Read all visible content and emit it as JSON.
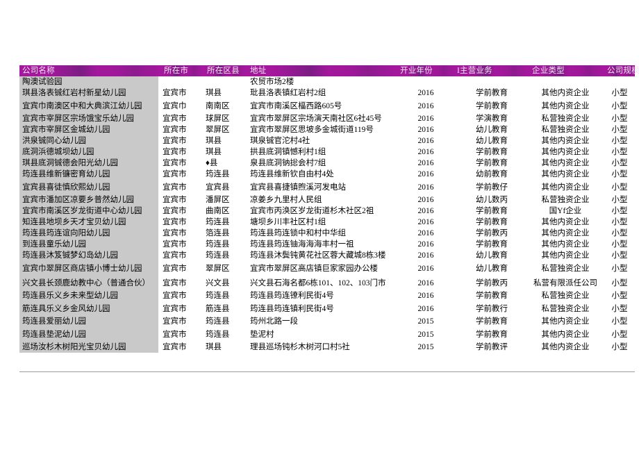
{
  "table": {
    "columns": [
      {
        "key": "name",
        "label": "公司名称"
      },
      {
        "key": "city",
        "label": "所在市"
      },
      {
        "key": "dist",
        "label": "所在区县"
      },
      {
        "key": "addr",
        "label": "地址"
      },
      {
        "key": "year",
        "label": "开业年份"
      },
      {
        "key": "biz",
        "label": "I主营业务"
      },
      {
        "key": "etype",
        "label": "企业类型"
      },
      {
        "key": "size",
        "label": "公司规模"
      }
    ],
    "header_color": "#a3189c",
    "name_column_shade": "#c9c9c9",
    "rows": [
      {
        "name": "陶澳试验园",
        "city": "",
        "dist": "",
        "addr": "农贸市场2楼",
        "year": "",
        "biz": "",
        "etype": "",
        "size": "",
        "gap_after": false
      },
      {
        "name": "琪县洛表铖红岩村新星幼儿园",
        "city": "宜宾市",
        "dist": "琪县",
        "addr": "玭县洛表镇红岩村2组",
        "year": "2016",
        "biz": "学前教育",
        "etype": "其他内资企业",
        "size": "小型",
        "gap_after": false
      },
      {
        "name": "宜宾巾南澳区中和大典滨江幼儿园",
        "city": "宜宾巾",
        "dist": "南南区",
        "addr": "宜宾市南溪区楅西路605号",
        "year": "2016",
        "biz": "学前教育",
        "etype": "其他内资企业",
        "size": "小型",
        "gap_after": true
      },
      {
        "name": "宜宾市宰屏区宗场饿宝乐幼儿园",
        "city": "宜宾市",
        "dist": "球屏区",
        "addr": "宜宾市翠屏区宗场演天南社区6社45号",
        "year": "2016",
        "biz": "学演教育",
        "etype": "私营独资企业",
        "size": "小型",
        "gap_after": false
      },
      {
        "name": "宜宾市宰屏区金城幼儿园",
        "city": "宜宾市",
        "dist": "翠屏区",
        "addr": "宜宾市翠屏区思坡多金城街道119号",
        "year": "2016",
        "biz": "幼儿教育",
        "etype": "私营独资企业",
        "size": "小型",
        "gap_after": false
      },
      {
        "name": "洪泉铖同心幼儿园",
        "city": "宜宾市",
        "dist": "琪县",
        "addr": "琪泉铖官沱村4社",
        "year": "2016",
        "biz": "幼儿教育",
        "etype": "其他内资企业",
        "size": "小型",
        "gap_after": false
      },
      {
        "name": "底洞浜德城坝幼儿园",
        "city": "宜宾市",
        "dist": "琪县",
        "addr": "拱县底洞镇憾利村1组",
        "year": "2016",
        "biz": "学前教育",
        "etype": "其他内资企业",
        "size": "小型",
        "gap_after": false
      },
      {
        "name": "琪县底洞铖德会阳光幼儿园",
        "city": "宜宾市",
        "dist": "♦县",
        "addr": "泉县底洞钠捴会村7组",
        "year": "2016",
        "biz": "学前教育",
        "etype": "其他内资企业",
        "size": "小型",
        "gap_after": false
      },
      {
        "name": "筠连县维新镰密育幼儿园",
        "city": "宜宾市",
        "dist": "筠连县",
        "addr": "筠连县维新钦自由村4处",
        "year": "2016",
        "biz": "幼前教育",
        "etype": "其他内资企业",
        "size": "小型",
        "gap_after": false
      },
      {
        "name": "宜宾县喜徒慎欣熙幼儿园",
        "city": "宜宾市",
        "dist": "宜宾县",
        "addr": "宜宾县喜捷镇煦溪河发电站",
        "year": "2016",
        "biz": "学前教仔",
        "etype": "其他内资企业",
        "size": "小型",
        "gap_after": true
      },
      {
        "name": "宜宾市潘加区凉要乡普然幼儿园",
        "city": "宜宾市",
        "dist": "潘屏区",
        "addr": "凉姜乡九里村人民组",
        "year": "2016",
        "biz": "幼儿数丙",
        "etype": "私营独资企业",
        "size": "小型",
        "gap_after": false
      },
      {
        "name": "宜宾市南溪区岁龙街道中心幼儿园",
        "city": "宜宾市",
        "dist": "曲南区",
        "addr": "宜宾市丙涣区岁龙街道杉木社区2祖",
        "year": "2016",
        "biz": "学前教育",
        "etype": "国Yf企业",
        "size": "小型",
        "gap_after": false
      },
      {
        "name": "知连县地坝乡天才宝贝幼儿园",
        "city": "宜宾市",
        "dist": "筠连县",
        "addr": "塘坝乡川丰社区村1组",
        "year": "2016",
        "biz": "学前教育",
        "etype": "其他内资企业",
        "size": "小型",
        "gap_after": false
      },
      {
        "name": "筠连县筠连谊向阳幼儿园",
        "city": "宜宾市",
        "dist": "箔连县",
        "addr": "筠连县筠连锁中和村中华组",
        "year": "2016",
        "biz": "学前教丙",
        "etype": "其他内资企业",
        "size": "小型",
        "gap_after": false
      },
      {
        "name": "到连县童乐幼儿园",
        "city": "宜宾市",
        "dist": "筠连县",
        "addr": "筠连县筠连铀海海海丰村一祖",
        "year": "2016",
        "biz": "学前教育",
        "etype": "其他内资企业",
        "size": "小型",
        "gap_after": false
      },
      {
        "name": "筠连县沐笈铖梦幻岛幼儿园",
        "city": "宜宾市",
        "dist": "筠连县",
        "addr": "筠连县沐鬓钝黄花社区蓉大藏城8栋3楼",
        "year": "2016",
        "biz": "幼儿教育",
        "etype": "其他内资企业",
        "size": "小型",
        "gap_after": false
      },
      {
        "name": "宜宾巾翠屏区商店镇小博士幼儿园",
        "city": "宜宾市",
        "dist": "翠屏区",
        "addr": "宜宾市翠屏区高店镇巨家家园办公楼",
        "year": "2016",
        "biz": "幼儿教育",
        "etype": "私营独资企业",
        "size": "小型",
        "gap_after": true
      },
      {
        "name": "兴文县长颈鹿幼教中心（普通合伙）",
        "city": "宜宾市",
        "dist": "兴文县",
        "addr": "兴文县石海名都6栋101、102、103门市",
        "year": "2016",
        "biz": "学前教丙",
        "etype": "私营有限派任公司",
        "size": "小型",
        "gap_after": true
      },
      {
        "name": "筠连县乐义乡未来型幼儿园",
        "city": "宜宾市",
        "dist": "筠连县",
        "addr": "筠连县筠连镣利民街4号",
        "year": "2016",
        "biz": "学前教育",
        "etype": "私营独资企业",
        "size": "小型",
        "gap_after": false
      },
      {
        "name": "筋连具乐义乡金风幼儿园",
        "city": "宜宾市",
        "dist": "筋连县",
        "addr": "筠连县筠连镇利民街4号",
        "year": "2016",
        "biz": "学前教行",
        "etype": "私营独资企业",
        "size": "小型",
        "gap_after": true
      },
      {
        "name": "筠连县爱丽幼儿园",
        "city": "宜宾市",
        "dist": "筠连县",
        "addr": "筠州北路一段",
        "year": "2015",
        "biz": "学前教育",
        "etype": "其他内资企业",
        "size": "小型",
        "gap_after": false
      },
      {
        "name": "筠连县垫泥幼儿园",
        "city": "宜宾市",
        "dist": "筠连县",
        "addr": "垫泥村",
        "year": "2015",
        "biz": "学前教育",
        "etype": "其他内资企业",
        "size": "小型",
        "gap_after": true
      },
      {
        "name": "巡场汝杉木树阳光宝贝幼儿园",
        "city": "宜宾市",
        "dist": "琪县",
        "addr": "理县巡场钝杉木树河口村5社",
        "year": "2015",
        "biz": "学前教评",
        "etype": "其他内资企业",
        "size": "小型",
        "gap_after": false
      }
    ]
  }
}
